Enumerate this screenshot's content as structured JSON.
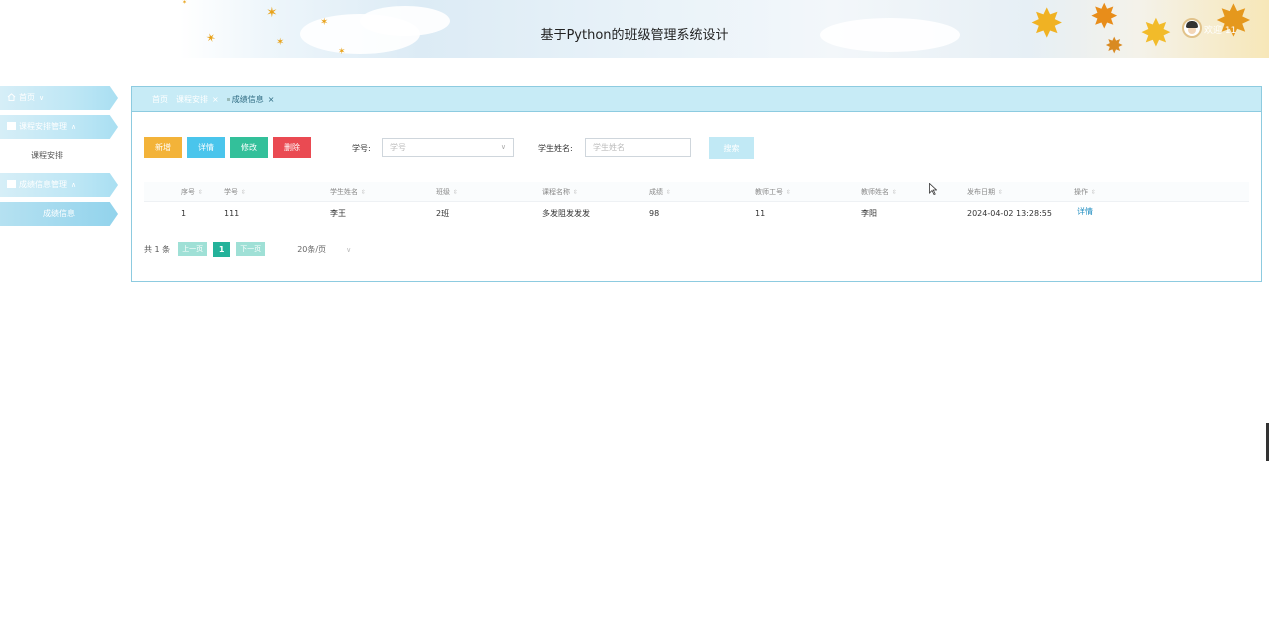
{
  "header": {
    "title": "基于Python的班级管理系统设计",
    "welcome": "欢迎 11"
  },
  "sidebar": {
    "items": [
      {
        "label": "首页",
        "icon": "home-icon"
      },
      {
        "label": "课程安排管理",
        "icon": "folder-icon",
        "sub": [
          "课程安排"
        ]
      },
      {
        "label": "成绩信息管理",
        "icon": "folder-icon",
        "sub": [
          "成绩信息"
        ]
      }
    ]
  },
  "tabs": [
    {
      "label": "首页"
    },
    {
      "label": "课程安排",
      "close": "×"
    },
    {
      "label": "成绩信息",
      "close": "×"
    }
  ],
  "toolbar": {
    "add": "新增",
    "detail": "详情",
    "edit": "修改",
    "delete": "删除"
  },
  "search": {
    "student_id_label": "学号:",
    "student_id_placeholder": "学号",
    "student_name_label": "学生姓名:",
    "student_name_placeholder": "学生姓名",
    "search_button": "搜索"
  },
  "table": {
    "columns": [
      "序号",
      "学号",
      "学生姓名",
      "班级",
      "课程名称",
      "成绩",
      "教师工号",
      "教师姓名",
      "发布日期",
      "操作"
    ],
    "rows": [
      {
        "index": "1",
        "student_id": "111",
        "student_name": "李王",
        "class": "2班",
        "course": "多发阻发发发",
        "score": "98",
        "teacher_id": "11",
        "teacher_name": "李阳",
        "date": "2024-04-02 13:28:55",
        "action": "详情"
      }
    ]
  },
  "pager": {
    "total": "共 1 条",
    "prev": "上一页",
    "page": "1",
    "next": "下一页",
    "size": "20条/页"
  },
  "colors": {
    "add": "#f3b339",
    "detail": "#4ac5ec",
    "edit": "#33c09a",
    "delete": "#ea4a52",
    "accent": "#8dcbe0"
  }
}
